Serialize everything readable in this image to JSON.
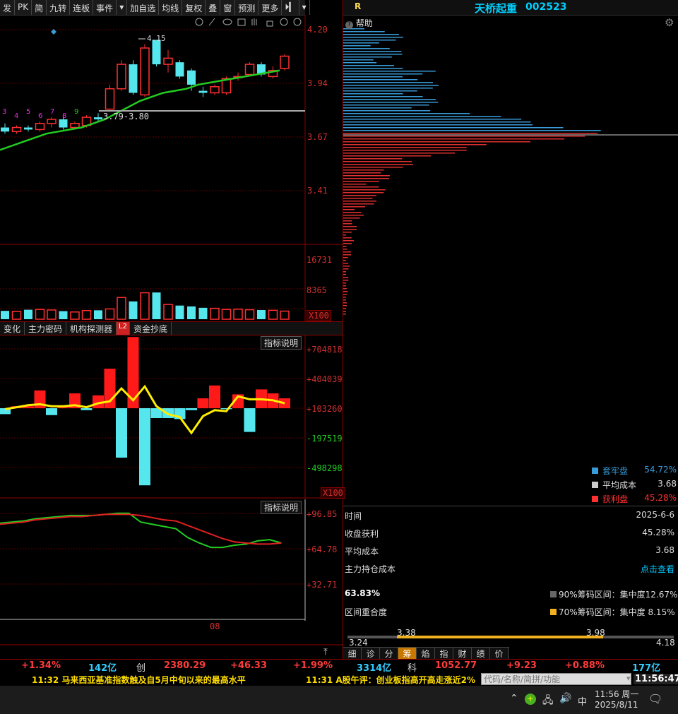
{
  "toolbar": {
    "items": [
      "发",
      "PK",
      "简",
      "九转",
      "连板",
      "事件",
      "▾",
      "加自选",
      "均线",
      "复权",
      "叠",
      "窗",
      "预测",
      "更多",
      "⏵▎",
      "▾"
    ]
  },
  "stock": {
    "label": "R",
    "name": "天桥起重",
    "code": "002523"
  },
  "chip_panel": {
    "help_label": "帮助",
    "legend": [
      {
        "name": "套牢盘",
        "value": "54.72%",
        "color": "#3a9bd9"
      },
      {
        "name": "平均成本",
        "value": "3.68",
        "color": "#cccccc"
      },
      {
        "name": "获利盘",
        "value": "45.28%",
        "color": "#ff3030"
      }
    ],
    "info": [
      {
        "label": "时间",
        "value": "2025-6-6"
      },
      {
        "label": "收盘获利",
        "value": "45.28%"
      },
      {
        "label": "平均成本",
        "value": "3.68"
      },
      {
        "label": "主力持仓成本",
        "value": "点击查看"
      }
    ],
    "overlap_pct": "63.83%",
    "overlap_label": "区间重合度",
    "range90": "90%筹码区间：集中度12.67%",
    "range70": "70%筹码区间：集中度  8.15%",
    "range_low": "3.24",
    "range_high": "4.18",
    "range_a": "3.38",
    "range_b": "3.98",
    "bottom_tabs": [
      "细",
      "诊",
      "分",
      "筹",
      "焰",
      "指",
      "财",
      "绩",
      "价"
    ]
  },
  "price_chart": {
    "y_labels": [
      "4.20",
      "3.94",
      "3.67",
      "3.41"
    ],
    "high_label": "4.15",
    "low_label": "3.79-3.80",
    "tick_nums": [
      "3",
      "4",
      "5",
      "6",
      "7",
      "8",
      "9"
    ],
    "candles": [
      {
        "o": 3.72,
        "c": 3.7,
        "h": 3.74,
        "l": 3.69
      },
      {
        "o": 3.7,
        "c": 3.72,
        "h": 3.73,
        "l": 3.69
      },
      {
        "o": 3.72,
        "c": 3.71,
        "h": 3.73,
        "l": 3.7
      },
      {
        "o": 3.71,
        "c": 3.74,
        "h": 3.75,
        "l": 3.7
      },
      {
        "o": 3.74,
        "c": 3.76,
        "h": 3.77,
        "l": 3.72
      },
      {
        "o": 3.76,
        "c": 3.72,
        "h": 3.78,
        "l": 3.71
      },
      {
        "o": 3.72,
        "c": 3.74,
        "h": 3.75,
        "l": 3.71
      },
      {
        "o": 3.73,
        "c": 3.77,
        "h": 3.78,
        "l": 3.72
      },
      {
        "o": 3.77,
        "c": 3.76,
        "h": 3.79,
        "l": 3.75
      },
      {
        "o": 3.81,
        "c": 3.91,
        "h": 3.93,
        "l": 3.8
      },
      {
        "o": 3.91,
        "c": 4.03,
        "h": 4.05,
        "l": 3.9
      },
      {
        "o": 4.03,
        "c": 3.89,
        "h": 4.05,
        "l": 3.88
      },
      {
        "o": 3.88,
        "c": 4.11,
        "h": 4.13,
        "l": 3.87
      },
      {
        "o": 4.15,
        "c": 4.03,
        "h": 4.15,
        "l": 4.02
      },
      {
        "o": 4.03,
        "c": 4.06,
        "h": 4.1,
        "l": 3.99
      },
      {
        "o": 4.04,
        "c": 3.97,
        "h": 4.05,
        "l": 3.96
      },
      {
        "o": 4.0,
        "c": 3.93,
        "h": 4.01,
        "l": 3.9
      },
      {
        "o": 3.9,
        "c": 3.89,
        "h": 3.92,
        "l": 3.87
      },
      {
        "o": 3.89,
        "c": 3.92,
        "h": 3.93,
        "l": 3.88
      },
      {
        "o": 3.89,
        "c": 3.96,
        "h": 3.97,
        "l": 3.88
      },
      {
        "o": 3.97,
        "c": 3.97,
        "h": 3.99,
        "l": 3.95
      },
      {
        "o": 3.98,
        "c": 4.03,
        "h": 4.04,
        "l": 3.97
      },
      {
        "o": 4.03,
        "c": 3.98,
        "h": 4.04,
        "l": 3.97
      },
      {
        "o": 3.97,
        "c": 4.0,
        "h": 4.02,
        "l": 3.96
      },
      {
        "o": 4.01,
        "c": 4.07,
        "h": 4.08,
        "l": 4.0
      }
    ],
    "ma": [
      3.61,
      3.63,
      3.65,
      3.67,
      3.69,
      3.7,
      3.71,
      3.72,
      3.74,
      3.76,
      3.79,
      3.82,
      3.85,
      3.87,
      3.89,
      3.9,
      3.91,
      3.93,
      3.94,
      3.95,
      3.96,
      3.97,
      3.98,
      3.99,
      4.0
    ]
  },
  "volume_chart": {
    "y_labels": [
      "16731",
      "8365"
    ],
    "unit": "X100",
    "bars": [
      3000,
      2800,
      3400,
      3500,
      3300,
      2900,
      2600,
      3100,
      3200,
      3700,
      7800,
      6400,
      9500,
      9600,
      5300,
      4900,
      4600,
      4100,
      3900,
      3500,
      3600,
      3400,
      3300,
      3200,
      2900
    ]
  },
  "indicator_tabs": [
    "变化",
    "主力密码",
    "机构探测器",
    "L2",
    "资金抄底"
  ],
  "indicator1": {
    "explain": "指标说明",
    "y_labels": [
      "+704818",
      "+404039",
      "+103260",
      "-197519",
      "-498298"
    ],
    "unit": "X100",
    "bars": [
      -60000,
      20000,
      20000,
      180000,
      -70000,
      20000,
      150000,
      -20000,
      130000,
      400000,
      -500000,
      720000,
      -780000,
      -100000,
      -100000,
      -110000,
      -20000,
      100000,
      230000,
      -10000,
      140000,
      -240000,
      190000,
      150000,
      100000
    ],
    "line": [
      -10000,
      10000,
      30000,
      40000,
      20000,
      20000,
      30000,
      10000,
      50000,
      70000,
      200000,
      80000,
      220000,
      20000,
      -60000,
      -90000,
      -250000,
      -80000,
      -20000,
      -30000,
      120000,
      90000,
      90000,
      80000,
      50000
    ]
  },
  "indicator2": {
    "explain": "指标说明",
    "y_labels": [
      "+96.85",
      "+64.78",
      "+32.71"
    ],
    "date_label": "08",
    "green": [
      88,
      89,
      90,
      92,
      93,
      94,
      95,
      95,
      95,
      96,
      97,
      97,
      89,
      87,
      85,
      83,
      75,
      70,
      66,
      66,
      68,
      69,
      72,
      73,
      70
    ],
    "red": [
      87,
      88,
      89,
      91,
      92,
      93,
      94,
      94,
      95,
      96,
      96,
      96,
      95,
      93,
      91,
      90,
      86,
      82,
      78,
      74,
      71,
      70,
      69,
      69,
      70
    ]
  },
  "status_bar": {
    "items": [
      "+1.34%",
      "142亿",
      "创",
      "2380.29",
      "+46.33",
      "+1.99%",
      "3314亿",
      "科",
      "1052.77",
      "+9.23",
      "+0.88%",
      "177亿"
    ]
  },
  "news": {
    "item1": "11:32 马来西亚基准指数触及自5月中旬以来的最高水平",
    "item2": "11:31 A股午评：创业板指高开高走涨近2%",
    "search_placeholder": "代码/名称/简拼/功能",
    "clock": "11:56:47"
  },
  "taskbar": {
    "ime": "中",
    "time": "11:56 周一",
    "date": "2025/8/11"
  }
}
